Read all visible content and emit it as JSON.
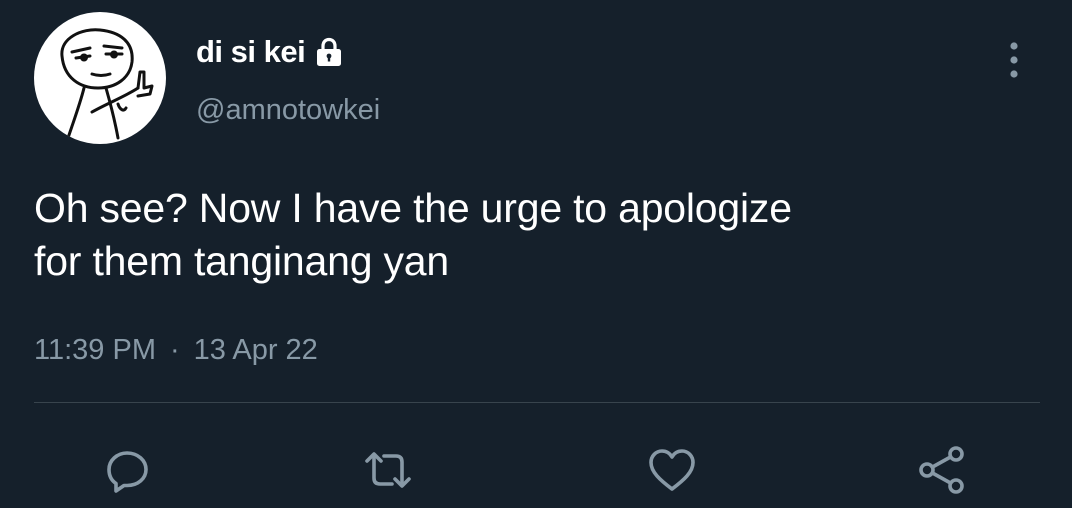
{
  "tweet": {
    "author": {
      "display_name": "di si kei",
      "handle": "@amnotowkei",
      "protected_icon": "lock-icon",
      "avatar_icon": "meme-face-avatar"
    },
    "text_line1": "Oh see? Now I have the urge to apologize",
    "text_line2": "for them tanginang yan",
    "time": "11:39 PM",
    "separator": "·",
    "date": "13 Apr 22"
  },
  "actions": [
    {
      "name": "reply",
      "icon": "reply-icon"
    },
    {
      "name": "retweet",
      "icon": "retweet-icon"
    },
    {
      "name": "like",
      "icon": "heart-icon"
    },
    {
      "name": "share",
      "icon": "share-icon"
    }
  ],
  "colors": {
    "background": "#15202b",
    "primary_text": "#ffffff",
    "secondary_text": "#8899a6",
    "divider": "#38444d"
  }
}
